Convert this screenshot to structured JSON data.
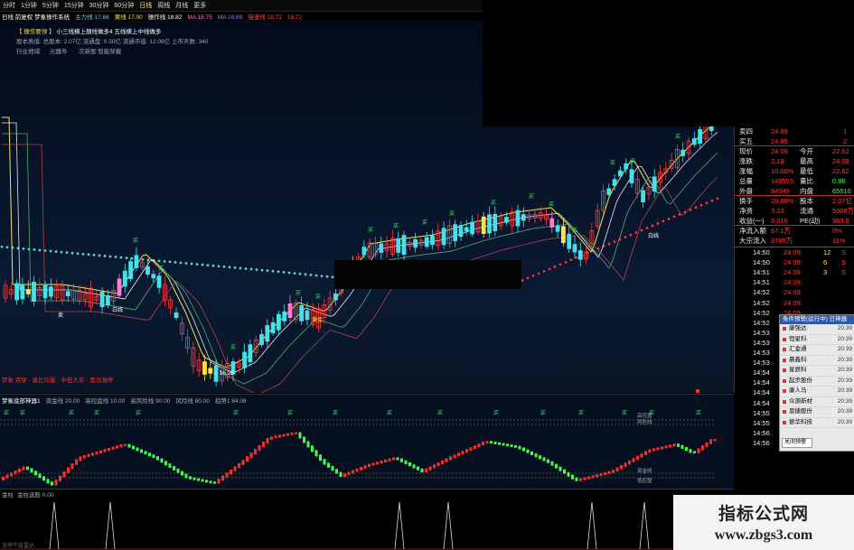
{
  "toolbar": {
    "items": [
      "分时",
      "1分钟",
      "5分钟",
      "15分钟",
      "30分钟",
      "60分钟",
      "日线",
      "周线",
      "月线",
      "更多"
    ],
    "active_index": 6
  },
  "title": {
    "main": "日线 前复权 梦象操作系统",
    "ma": [
      {
        "label": "主力线 17.66",
        "color": "#5ad7ff"
      },
      {
        "label": "黄线 17.00",
        "color": "#ffe24a"
      },
      {
        "label": "操作线 18.82",
        "color": "#ffffff"
      },
      {
        "label": "MA 18.75",
        "color": "#ff6bd6"
      },
      {
        "label": "MA 19.89",
        "color": "#9a7bff"
      },
      {
        "label": "慢速线 18.72",
        "color": "#ff4040"
      },
      {
        "label": "18.72",
        "color": "#ff4040"
      }
    ]
  },
  "info": {
    "line1_bracket": "【 操作要领 】",
    "line1_text": "小三线横上翘线做多4  五线横上中线做多",
    "line2": "股本质值: 总股本: 2.07亿  流通盘: 0.50亿  流通市值: 12.09亿  上市天数: 340",
    "line3_label": "行业地域:",
    "line3_a": "元器件",
    "line3_b": "次新股  智能穿戴"
  },
  "chart_labels": {
    "signal_buy": "买",
    "signal_sell": "卖",
    "low_price": "16.26",
    "label_white": "白线",
    "label_yellow": "黄金",
    "label_red_note": "白线"
  },
  "legend_row": "梦象 双穿 · 量比均量 · 中低大买 · 黑马涨停",
  "sub_header": [
    "梦象底部神器1",
    "资金线 20.00",
    "高控盘线 10.00",
    "高风险线 90.00",
    "风险线 80.00",
    "趋势1 84.08"
  ],
  "sub_labels": {
    "r1": "高控盘",
    "r2": "风险线",
    "r3": "资金线",
    "r4": "低控盘"
  },
  "bot_header": [
    "金柱",
    "金柱选股 0.00"
  ],
  "bot_note": "涨停牛股雷达",
  "quote": {
    "rows": [
      {
        "k": "卖四",
        "v": "24.89",
        "n": "1"
      },
      {
        "k": "买五",
        "v": "24.85",
        "n": "2"
      },
      {
        "k": "现价",
        "v": "24.09",
        "k2": "今开",
        "v2": "22.62"
      },
      {
        "k": "涨跌",
        "v": "2.19",
        "k2": "最高",
        "v2": "24.09"
      },
      {
        "k": "涨幅",
        "v": "10.00%",
        "k2": "最低",
        "v2": "22.62"
      },
      {
        "k": "总量",
        "v": "149555",
        "k2": "量比",
        "v2": "0.86"
      },
      {
        "k": "外盘",
        "v": "84045",
        "k2": "内盘",
        "v2": "65510"
      },
      {
        "k": "换手",
        "v": "29.86%",
        "k2": "股本",
        "v2": "2.07亿"
      },
      {
        "k": "净资",
        "v": "3.23",
        "k2": "流通",
        "v2": "5008万"
      },
      {
        "k": "收益(一)",
        "v": "0.016",
        "k2": "PE(动)",
        "v2": "369.9"
      },
      {
        "k": "净流入额",
        "v": "67.1万",
        "v2": "0%"
      },
      {
        "k": "大宗流入",
        "v": "3785万",
        "v2": "11%"
      }
    ],
    "ticks": [
      {
        "t": "14:50",
        "p": "24.09",
        "v": "12",
        "f": "S"
      },
      {
        "t": "14:50",
        "p": "24.09",
        "v": "6",
        "f": "S"
      },
      {
        "t": "14:51",
        "p": "24.09",
        "v": "3",
        "f": "S"
      },
      {
        "t": "14:51",
        "p": "24.09",
        "v": "",
        "f": ""
      },
      {
        "t": "14:52",
        "p": "24.09",
        "v": "",
        "f": ""
      },
      {
        "t": "14:52",
        "p": "24.09",
        "v": "",
        "f": ""
      },
      {
        "t": "14:52",
        "p": "24.09",
        "v": "",
        "f": ""
      },
      {
        "t": "14:52",
        "p": "24.09",
        "v": "",
        "f": ""
      },
      {
        "t": "14:53",
        "p": "24.09",
        "v": "",
        "f": ""
      },
      {
        "t": "14:53",
        "p": "24.09",
        "v": "",
        "f": ""
      },
      {
        "t": "14:53",
        "p": "24.09",
        "v": "",
        "f": ""
      },
      {
        "t": "14:53",
        "p": "24.09",
        "v": "",
        "f": ""
      },
      {
        "t": "14:54",
        "p": "24.09",
        "v": "",
        "f": ""
      },
      {
        "t": "14:54",
        "p": "24.09",
        "v": "",
        "f": ""
      },
      {
        "t": "14:54",
        "p": "24.09",
        "v": "100",
        "f": "S"
      },
      {
        "t": "14:54",
        "p": "24.09",
        "v": "2",
        "f": "S"
      },
      {
        "t": "14:55",
        "p": "24.09",
        "v": "4",
        "f": "S"
      },
      {
        "t": "14:55",
        "p": "24.09",
        "v": "8",
        "f": "S"
      },
      {
        "t": "14:56",
        "p": "24.09",
        "v": "1",
        "f": "S"
      },
      {
        "t": "14:56",
        "p": "24.09",
        "v": "6",
        "f": "S"
      }
    ]
  },
  "popup": {
    "title": "条件预警(运行中) 日神器",
    "items": [
      {
        "name": "康强达",
        "time": "20:39"
      },
      {
        "name": "恒星科",
        "time": "20:39"
      },
      {
        "name": "汇金通",
        "time": "20:39"
      },
      {
        "name": "晨鑫科",
        "time": "20:39"
      },
      {
        "name": "星辰科",
        "time": "20:39"
      },
      {
        "name": "起步股份",
        "time": "20:39"
      },
      {
        "name": "康人马",
        "time": "20:39"
      },
      {
        "name": "众源新材",
        "time": "20:39"
      },
      {
        "name": "恩捷股份",
        "time": "20:39"
      },
      {
        "name": "振华科技",
        "time": "20:39"
      }
    ],
    "input": "关闭预警"
  },
  "watermark": {
    "line1": "指标公式网",
    "line2": "www.zbgs3.com"
  },
  "colors": {
    "up": "#ff3b3b",
    "down": "#46e0e8",
    "buy": "#3cff6a",
    "yellow": "#ffe24a"
  }
}
